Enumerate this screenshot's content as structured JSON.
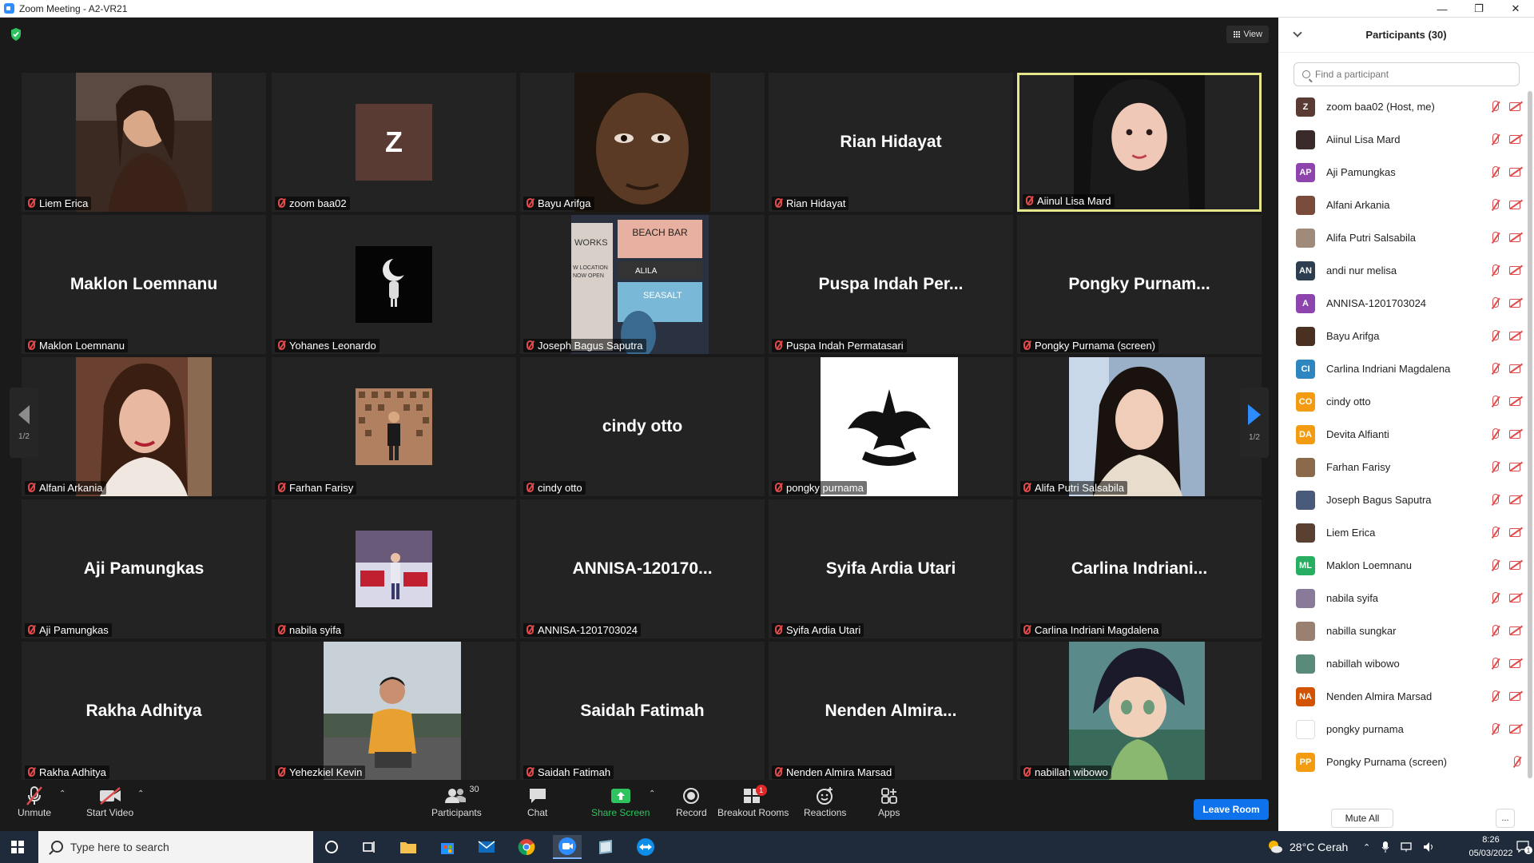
{
  "window": {
    "title": "Zoom Meeting - A2-VR21"
  },
  "meeting": {
    "view_label": "View",
    "page_indicator_left": "1/2",
    "page_indicator_right": "1/2"
  },
  "tiles": [
    {
      "name": "Liem Erica",
      "big": ""
    },
    {
      "name": "zoom baa02",
      "big": "Z"
    },
    {
      "name": "Bayu Arifga",
      "big": ""
    },
    {
      "name": "Rian Hidayat",
      "big": "Rian Hidayat"
    },
    {
      "name": "Aiinul Lisa Mard",
      "big": ""
    },
    {
      "name": "Maklon Loemnanu",
      "big": "Maklon Loemnanu"
    },
    {
      "name": "Yohanes Leonardo",
      "big": ""
    },
    {
      "name": "Joseph Bagus Saputra",
      "big": ""
    },
    {
      "name": "Puspa Indah Permatasari",
      "big": "Puspa Indah Per..."
    },
    {
      "name": "Pongky Purnama (screen)",
      "big": "Pongky  Purnam..."
    },
    {
      "name": "Alfani Arkania",
      "big": ""
    },
    {
      "name": "Farhan Farisy",
      "big": ""
    },
    {
      "name": "cindy otto",
      "big": "cindy otto"
    },
    {
      "name": "pongky purnama",
      "big": ""
    },
    {
      "name": "Alifa Putri Salsabila",
      "big": ""
    },
    {
      "name": "Aji Pamungkas",
      "big": "Aji Pamungkas"
    },
    {
      "name": "nabila syifa",
      "big": ""
    },
    {
      "name": "ANNISA-1201703024",
      "big": "ANNISA-120170..."
    },
    {
      "name": "Syifa Ardia Utari",
      "big": "Syifa Ardia Utari"
    },
    {
      "name": "Carlina Indriani Magdalena",
      "big": "Carlina  Indriani..."
    },
    {
      "name": "Rakha Adhitya",
      "big": "Rakha Adhitya"
    },
    {
      "name": "Yehezkiel Kevin",
      "big": ""
    },
    {
      "name": "Saidah Fatimah",
      "big": "Saidah Fatimah"
    },
    {
      "name": "Nenden Almira Marsad",
      "big": "Nenden  Almira..."
    },
    {
      "name": "nabillah wibowo",
      "big": ""
    }
  ],
  "thumb_text": {
    "beach_bar": "BEACH BAR",
    "alila": "ALILA",
    "seasalt": "SEASALT",
    "works": "WORKS",
    "location": "W LOCATION",
    "open": "NOW OPEN"
  },
  "toolbar": {
    "unmute": "Unmute",
    "start_video": "Start Video",
    "participants": "Participants",
    "participants_count": "30",
    "chat": "Chat",
    "share_screen": "Share Screen",
    "record": "Record",
    "breakout_rooms": "Breakout Rooms",
    "breakout_badge": "1",
    "reactions": "Reactions",
    "apps": "Apps",
    "leave_room": "Leave Room"
  },
  "panel": {
    "title": "Participants (30)",
    "search_placeholder": "Find a participant",
    "mute_all": "Mute All",
    "more": "...",
    "participants": [
      {
        "name": "zoom baa02 (Host, me)",
        "initials": "Z",
        "color": "#5a3b34",
        "photo": false,
        "video": true
      },
      {
        "name": "Aiinul Lisa Mard",
        "initials": "",
        "color": "#3a2a2a",
        "photo": true,
        "video": true
      },
      {
        "name": "Aji Pamungkas",
        "initials": "AP",
        "color": "#8e44ad",
        "photo": false,
        "video": true
      },
      {
        "name": "Alfani Arkania",
        "initials": "",
        "color": "#7a4a3a",
        "photo": true,
        "video": true
      },
      {
        "name": "Alifa Putri Salsabila",
        "initials": "",
        "color": "#a08a7a",
        "photo": true,
        "video": true
      },
      {
        "name": "andi nur melisa",
        "initials": "AN",
        "color": "#2c3e50",
        "photo": false,
        "video": true
      },
      {
        "name": "ANNISA-1201703024",
        "initials": "A",
        "color": "#8e44ad",
        "photo": false,
        "video": true
      },
      {
        "name": "Bayu Arifga",
        "initials": "",
        "color": "#4a3020",
        "photo": true,
        "video": true
      },
      {
        "name": "Carlina Indriani Magdalena",
        "initials": "CI",
        "color": "#2e86c1",
        "photo": false,
        "video": true
      },
      {
        "name": "cindy otto",
        "initials": "CO",
        "color": "#f39c12",
        "photo": false,
        "video": true
      },
      {
        "name": "Devita Alfianti",
        "initials": "DA",
        "color": "#f39c12",
        "photo": false,
        "video": true
      },
      {
        "name": "Farhan Farisy",
        "initials": "",
        "color": "#8a6a4a",
        "photo": true,
        "video": true
      },
      {
        "name": "Joseph Bagus Saputra",
        "initials": "",
        "color": "#4a5a7a",
        "photo": true,
        "video": true
      },
      {
        "name": "Liem Erica",
        "initials": "",
        "color": "#5a4030",
        "photo": true,
        "video": true
      },
      {
        "name": "Maklon Loemnanu",
        "initials": "ML",
        "color": "#27ae60",
        "photo": false,
        "video": true
      },
      {
        "name": "nabila syifa",
        "initials": "",
        "color": "#8a7a9a",
        "photo": true,
        "video": true
      },
      {
        "name": "nabilla sungkar",
        "initials": "",
        "color": "#9a8070",
        "photo": true,
        "video": true
      },
      {
        "name": "nabillah wibowo",
        "initials": "",
        "color": "#5a8a7a",
        "photo": true,
        "video": true
      },
      {
        "name": "Nenden Almira Marsad",
        "initials": "NA",
        "color": "#d35400",
        "photo": false,
        "video": true
      },
      {
        "name": "pongky purnama",
        "initials": "",
        "color": "#ffffff",
        "photo": true,
        "video": true
      },
      {
        "name": "Pongky Purnama (screen)",
        "initials": "PP",
        "color": "#f39c12",
        "photo": false,
        "video": false
      }
    ]
  },
  "taskbar": {
    "search_placeholder": "Type here to search",
    "weather": "28°C  Cerah",
    "time": "8:26",
    "date": "05/03/2022",
    "notifications": "1"
  }
}
